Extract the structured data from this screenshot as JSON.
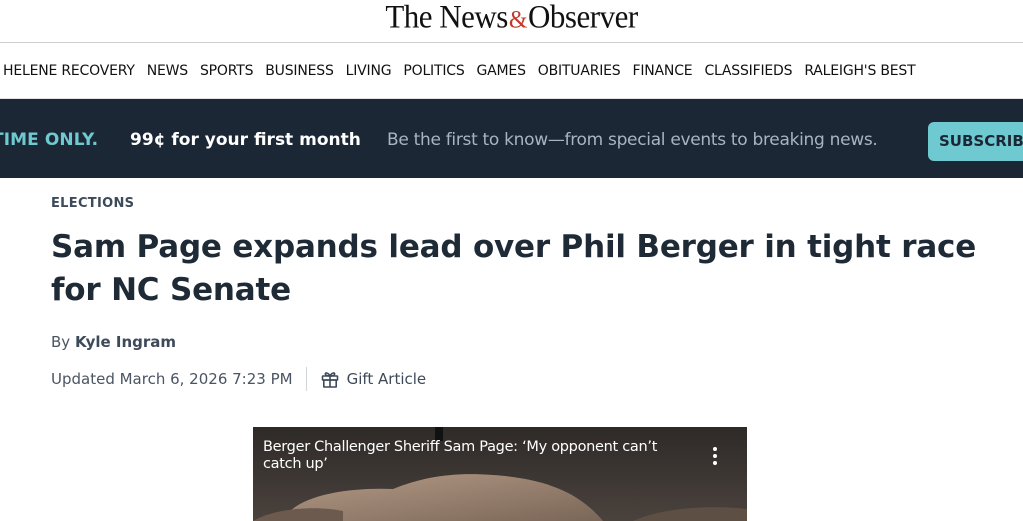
{
  "masthead": {
    "logo_part1": "The News",
    "logo_amp": "&",
    "logo_part2": "Observer"
  },
  "nav": {
    "items": [
      "HELENE RECOVERY",
      "NEWS",
      "SPORTS",
      "BUSINESS",
      "LIVING",
      "POLITICS",
      "GAMES",
      "OBITUARIES",
      "FINANCE",
      "CLASSIFIEDS",
      "RALEIGH'S BEST"
    ]
  },
  "promo": {
    "limited": "TIME ONLY.",
    "price_prefix": "99¢ for your ",
    "price_emph": "first month",
    "description": "Be the first to know—from special events to breaking news.",
    "button_label": "SUBSCRIBE"
  },
  "article": {
    "section": "ELECTIONS",
    "headline": "Sam Page expands lead over Phil Berger in tight race for NC Senate",
    "byline_prefix": "By ",
    "author": "Kyle Ingram",
    "updated": "Updated March 6, 2026 7:23 PM",
    "gift_label": "Gift Article"
  },
  "video": {
    "title": "Berger Challenger Sheriff Sam Page: ‘My opponent can’t catch up’",
    "menu_icon": "more-vertical-icon"
  },
  "colors": {
    "promo_bg": "#1b2735",
    "accent_teal": "#6fc9d0",
    "headline": "#1e2a36"
  }
}
